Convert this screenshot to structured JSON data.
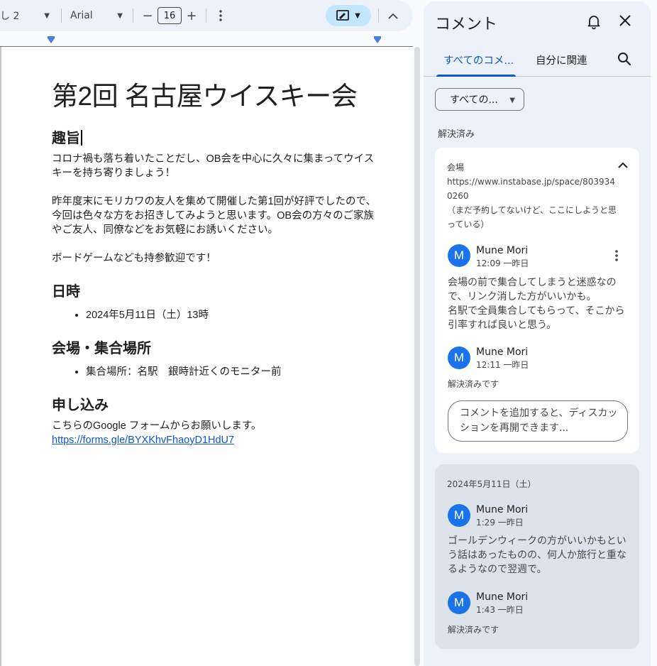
{
  "toolbar": {
    "style_label": "し 2",
    "font_label": "Arial",
    "font_size": "16",
    "minus": "−",
    "plus": "+"
  },
  "doc": {
    "title": "第2回 名古屋ウイスキー会",
    "sections": {
      "purpose_heading": "趣旨",
      "purpose_p1": "コロナ禍も落ち着いたことだし、OB会を中心に久々に集まってウイスキーを持ち寄りましょう！",
      "purpose_p2": "昨年度末にモリカワの友人を集めて開催した第1回が好評でしたので、今回は色々な方をお招きしてみようと思います。OB会の方々のご家族やご友人、同僚などをお気軽にお誘いください。",
      "purpose_p3": "ボードゲームなども持参歓迎です！",
      "date_heading": "日時",
      "date_item": "2024年5月11日（土）13時",
      "venue_heading": "会場・集合場所",
      "venue_item": "集合場所：名駅　銀時計近くのモニター前",
      "apply_heading": "申し込み",
      "apply_text": "こちらのGoogle フォームからお願いします。",
      "apply_link": "https://forms.gle/BYXKhvFhaoyD1HdU7"
    }
  },
  "comments_panel": {
    "title": "コメント",
    "tabs": {
      "all": "すべてのコメ...",
      "mine": "自分に関連"
    },
    "filter": "すべての...",
    "section_label": "解決済み",
    "thread1": {
      "context_label": "会場",
      "context_url": "https://www.instabase.jp/space/8039340260",
      "context_note": "（まだ予約してないけど、ここにしようと思っている）",
      "comment1": {
        "avatar": "M",
        "author": "Mune Mori",
        "time": "12:09 一昨日",
        "text": "会場の前で集合してしまうと迷惑なので、リンク消した方がいいかも。\n名駅で全員集合してもらって、そこから引率すれば良いと思う。"
      },
      "comment2": {
        "avatar": "M",
        "author": "Mune Mori",
        "time": "12:11 一昨日"
      },
      "resolved": "解決済みです",
      "reply_placeholder": "コメントを追加すると、ディスカッションを再開できます..."
    },
    "thread2": {
      "context_label": "2024年5月11日（土）",
      "comment1": {
        "avatar": "M",
        "author": "Mune Mori",
        "time": "1:29 一昨日",
        "text": "ゴールデンウィークの方がいいかもという話はあったものの、何人か旅行と重なるようなので翌週で。"
      },
      "comment2": {
        "avatar": "M",
        "author": "Mune Mori",
        "time": "1:43 一昨日"
      },
      "resolved": "解決済みです"
    },
    "colors": {
      "accent": "#0b57d0",
      "avatar": "#1a73e8",
      "panel_bg": "#edf2fa"
    }
  }
}
